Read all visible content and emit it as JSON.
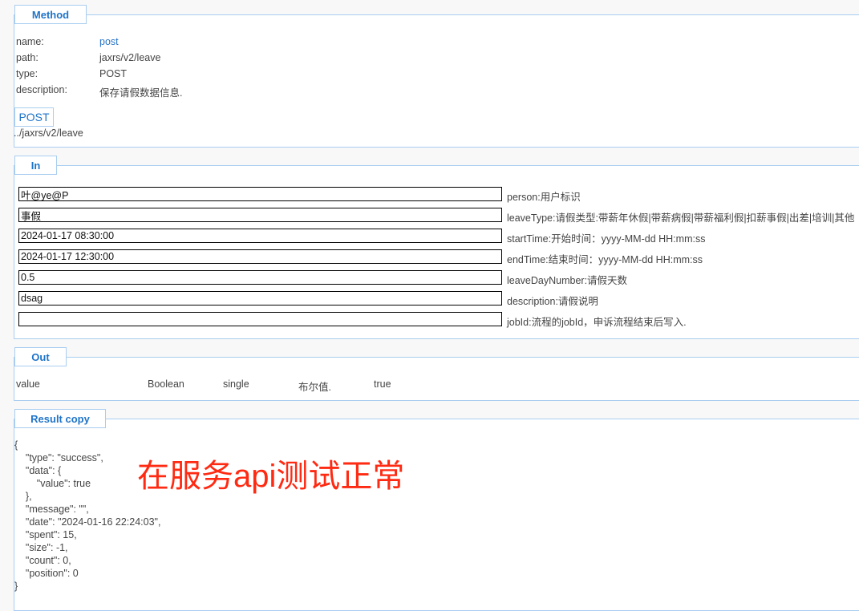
{
  "method": {
    "legend": "Method",
    "fields": [
      {
        "label": "name:",
        "value": "post"
      },
      {
        "label": "path:",
        "value": "jaxrs/v2/leave"
      },
      {
        "label": "type:",
        "value": "POST"
      },
      {
        "label": "description:",
        "value": "保存请假数据信息."
      }
    ],
    "badge": "POST",
    "url": "../jaxrs/v2/leave"
  },
  "in": {
    "legend": "In",
    "params": [
      {
        "value": "叶@ye@P",
        "label": "person:用户标识"
      },
      {
        "value": "事假",
        "label": "leaveType:请假类型:带薪年休假|带薪病假|带薪福利假|扣薪事假|出差|培训|其他"
      },
      {
        "value": "2024-01-17 08:30:00",
        "label": "startTime:开始时间：yyyy-MM-dd HH:mm:ss"
      },
      {
        "value": "2024-01-17 12:30:00",
        "label": "endTime:结束时间：yyyy-MM-dd HH:mm:ss"
      },
      {
        "value": "0.5",
        "label": "leaveDayNumber:请假天数"
      },
      {
        "value": "dsag",
        "label": "description:请假说明"
      },
      {
        "value": "",
        "label": "jobId:流程的jobId，申诉流程结束后写入."
      }
    ]
  },
  "out": {
    "legend": "Out",
    "row": {
      "name": "value",
      "type": "Boolean",
      "multiplicity": "single",
      "description": "布尔值.",
      "example": "true"
    }
  },
  "result": {
    "legend": "Result copy",
    "json": "{\n    \"type\": \"success\",\n    \"data\": {\n        \"value\": true\n    },\n    \"message\": \"\",\n    \"date\": \"2024-01-16 22:24:03\",\n    \"spent\": 15,\n    \"size\": -1,\n    \"count\": 0,\n    \"position\": 0\n}",
    "annotation": "在服务api测试正常",
    "annotation_color": "#ff2a12"
  }
}
